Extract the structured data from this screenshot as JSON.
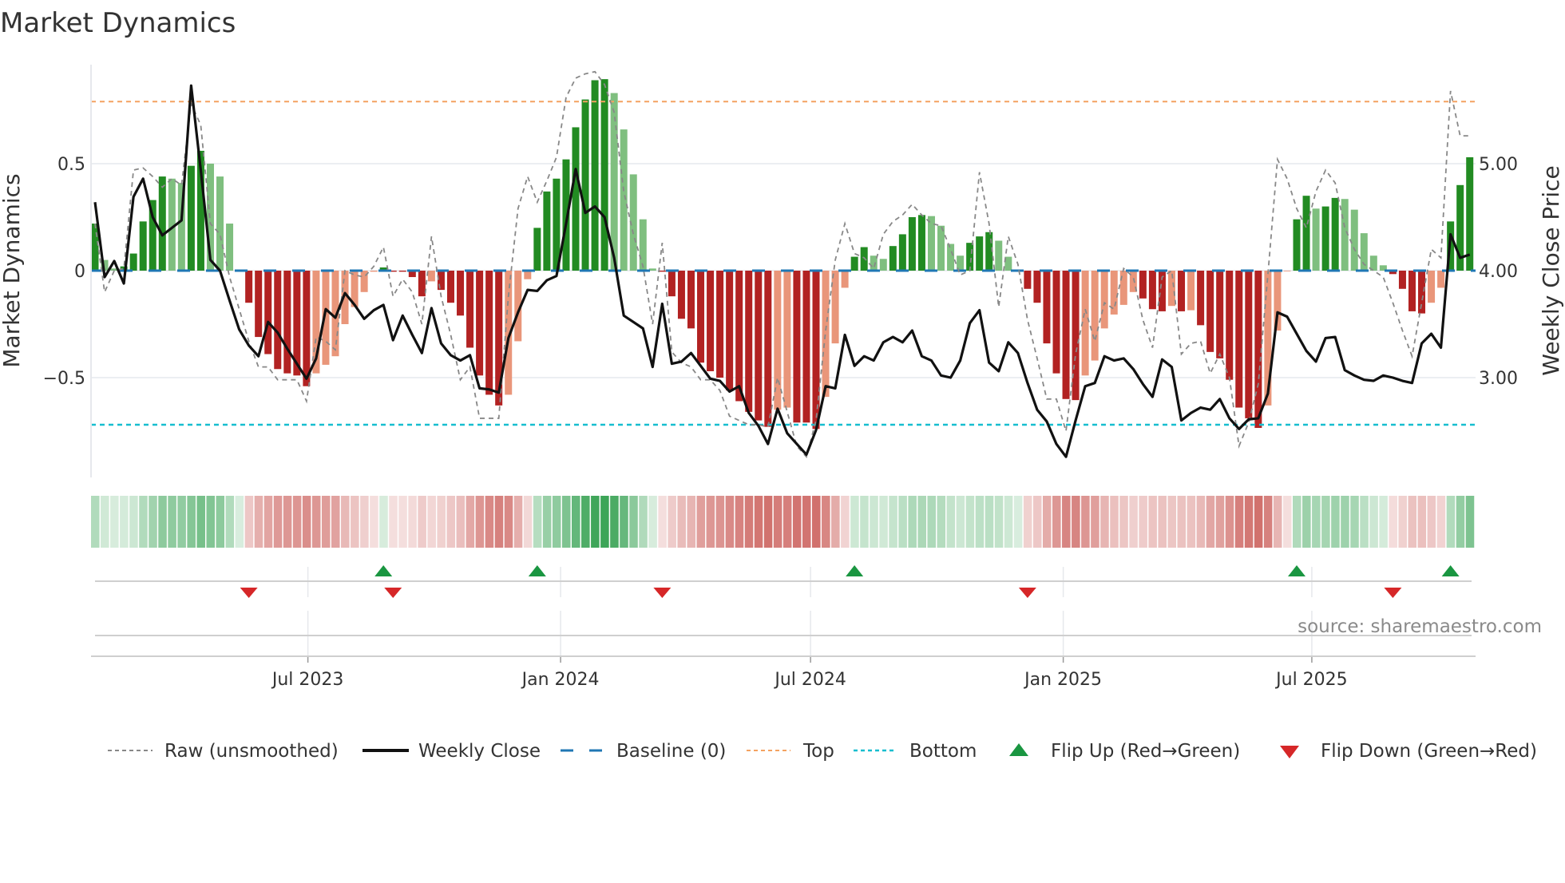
{
  "title": "Market Dynamics",
  "source": "source: sharemaestro.com",
  "chart_data": {
    "type": "bar",
    "title": "Market Dynamics",
    "ylabel": "Market Dynamics",
    "y2label": "Weekly Close Price",
    "ylim": [
      -0.97,
      0.96
    ],
    "y2lim": [
      2.06,
      5.92
    ],
    "frequency": "weekly",
    "start_week": "2023-01-27",
    "yticks": [
      {
        "value": 0.5,
        "label": "0.5"
      },
      {
        "value": 0,
        "label": "0"
      },
      {
        "value": -0.5,
        "label": "−0.5"
      }
    ],
    "y2ticks": [
      {
        "value": 5,
        "label": "5.00"
      },
      {
        "value": 4,
        "label": "4.00"
      },
      {
        "value": 3,
        "label": "3.00"
      }
    ],
    "xticks": [
      {
        "date": "2023-07-01",
        "label": "Jul 2023"
      },
      {
        "date": "2024-01-01",
        "label": "Jan 2024"
      },
      {
        "date": "2024-07-01",
        "label": "Jul 2024"
      },
      {
        "date": "2025-01-01",
        "label": "Jan 2025"
      },
      {
        "date": "2025-07-01",
        "label": "Jul 2025"
      }
    ],
    "top_level": 0.79,
    "bottom_level": -0.72,
    "baseline": 0,
    "colors": {
      "rising_positive": "#228b22",
      "falling_positive": "#7fbf7f",
      "falling_negative": "#b22222",
      "rising_negative": "#e9967a",
      "raw": "#888888",
      "close": "#111111",
      "baseline": "#1f77b4",
      "top": "#f4a261",
      "bottom": "#17becf",
      "flip_up": "#1a9641",
      "flip_down": "#d62728"
    },
    "dynamics": [
      0.22,
      0.05,
      0.01,
      0.02,
      0.08,
      0.23,
      0.33,
      0.44,
      0.43,
      0.41,
      0.49,
      0.56,
      0.5,
      0.44,
      0.22,
      0.003,
      -0.15,
      -0.31,
      -0.39,
      -0.46,
      -0.48,
      -0.49,
      -0.54,
      -0.48,
      -0.44,
      -0.4,
      -0.25,
      -0.17,
      -0.1,
      -0.005,
      0.015,
      -0.005,
      -0.005,
      -0.03,
      -0.12,
      -0.05,
      -0.09,
      -0.15,
      -0.21,
      -0.36,
      -0.49,
      -0.58,
      -0.63,
      -0.58,
      -0.33,
      -0.04,
      0.2,
      0.37,
      0.43,
      0.52,
      0.67,
      0.8,
      0.89,
      0.895,
      0.83,
      0.66,
      0.45,
      0.24,
      0.01,
      -0.005,
      -0.12,
      -0.225,
      -0.27,
      -0.43,
      -0.47,
      -0.5,
      -0.56,
      -0.61,
      -0.66,
      -0.7,
      -0.73,
      -0.65,
      -0.64,
      -0.71,
      -0.71,
      -0.74,
      -0.59,
      -0.34,
      -0.08,
      0.065,
      0.11,
      0.07,
      0.055,
      0.115,
      0.17,
      0.25,
      0.26,
      0.255,
      0.21,
      0.125,
      0.07,
      0.13,
      0.16,
      0.18,
      0.14,
      0.065,
      0.003,
      -0.085,
      -0.15,
      -0.34,
      -0.48,
      -0.6,
      -0.605,
      -0.49,
      -0.42,
      -0.27,
      -0.205,
      -0.16,
      -0.1,
      -0.13,
      -0.18,
      -0.19,
      -0.165,
      -0.19,
      -0.185,
      -0.255,
      -0.38,
      -0.41,
      -0.51,
      -0.64,
      -0.69,
      -0.735,
      -0.63,
      -0.28,
      -0.003,
      0.24,
      0.35,
      0.29,
      0.3,
      0.34,
      0.335,
      0.285,
      0.175,
      0.07,
      0.025,
      -0.016,
      -0.085,
      -0.19,
      -0.2,
      -0.15,
      -0.08,
      0.23,
      0.4,
      0.53
    ],
    "raw": [
      0.22,
      -0.1,
      0.0,
      0.01,
      0.47,
      0.48,
      0.44,
      0.39,
      0.43,
      0.4,
      0.78,
      0.68,
      0.22,
      0.17,
      -0.03,
      -0.18,
      -0.33,
      -0.45,
      -0.45,
      -0.51,
      -0.51,
      -0.51,
      -0.61,
      -0.31,
      -0.33,
      -0.37,
      0.0,
      -0.02,
      -0.03,
      0.02,
      0.11,
      -0.12,
      -0.04,
      -0.1,
      -0.25,
      0.16,
      -0.12,
      -0.3,
      -0.51,
      -0.45,
      -0.69,
      -0.69,
      -0.69,
      -0.12,
      0.29,
      0.44,
      0.32,
      0.42,
      0.53,
      0.81,
      0.9,
      0.92,
      0.93,
      0.87,
      0.74,
      0.37,
      0.17,
      0.02,
      -0.25,
      0.13,
      -0.38,
      -0.43,
      -0.45,
      -0.51,
      -0.51,
      -0.56,
      -0.68,
      -0.7,
      -0.72,
      -0.72,
      -0.73,
      -0.5,
      -0.66,
      -0.82,
      -0.87,
      -0.7,
      -0.28,
      0.05,
      0.22,
      0.08,
      0.06,
      0.01,
      0.17,
      0.23,
      0.26,
      0.31,
      0.26,
      0.22,
      0.21,
      0.1,
      -0.02,
      0.0,
      0.46,
      0.22,
      -0.17,
      0.16,
      0.03,
      -0.23,
      -0.41,
      -0.6,
      -0.6,
      -0.75,
      -0.39,
      -0.18,
      -0.33,
      -0.15,
      -0.18,
      0.01,
      -0.03,
      -0.23,
      -0.36,
      -0.03,
      0.0,
      -0.39,
      -0.34,
      -0.33,
      -0.48,
      -0.39,
      -0.5,
      -0.82,
      -0.71,
      -0.53,
      -0.02,
      0.52,
      0.43,
      0.29,
      0.2,
      0.37,
      0.47,
      0.41,
      0.2,
      0.1,
      0.03,
      0.0,
      -0.03,
      -0.15,
      -0.28,
      -0.4,
      -0.15,
      0.1,
      0.06,
      0.84,
      0.63,
      0.63
    ],
    "weekly_close": [
      4.64,
      3.94,
      4.09,
      3.88,
      4.69,
      4.86,
      4.5,
      4.33,
      4.4,
      4.47,
      5.73,
      4.94,
      4.1,
      4.0,
      3.72,
      3.45,
      3.3,
      3.2,
      3.52,
      3.42,
      3.27,
      3.13,
      2.99,
      3.18,
      3.64,
      3.56,
      3.79,
      3.68,
      3.55,
      3.63,
      3.68,
      3.35,
      3.58,
      3.4,
      3.23,
      3.65,
      3.32,
      3.21,
      3.16,
      3.21,
      2.9,
      2.89,
      2.86,
      3.37,
      3.61,
      3.82,
      3.81,
      3.91,
      3.95,
      4.44,
      4.95,
      4.54,
      4.6,
      4.5,
      4.12,
      3.58,
      3.52,
      3.46,
      3.1,
      3.69,
      3.13,
      3.15,
      3.23,
      3.11,
      2.99,
      2.97,
      2.87,
      2.92,
      2.67,
      2.55,
      2.38,
      2.71,
      2.48,
      2.38,
      2.28,
      2.51,
      2.92,
      2.9,
      3.4,
      3.11,
      3.2,
      3.16,
      3.33,
      3.38,
      3.33,
      3.44,
      3.2,
      3.16,
      3.02,
      3.0,
      3.16,
      3.51,
      3.63,
      3.14,
      3.06,
      3.33,
      3.23,
      2.95,
      2.7,
      2.59,
      2.38,
      2.26,
      2.6,
      2.92,
      2.95,
      3.2,
      3.16,
      3.18,
      3.08,
      2.94,
      2.82,
      3.17,
      3.1,
      2.6,
      2.67,
      2.72,
      2.7,
      2.8,
      2.62,
      2.52,
      2.61,
      2.62,
      2.85,
      3.61,
      3.57,
      3.41,
      3.25,
      3.15,
      3.37,
      3.38,
      3.07,
      3.02,
      2.98,
      2.97,
      3.02,
      3.0,
      2.97,
      2.95,
      3.32,
      3.41,
      3.28,
      4.34,
      4.12,
      4.15
    ],
    "legend": {
      "raw": "Raw (unsmoothed)",
      "close": "Weekly Close",
      "baseline": "Baseline (0)",
      "top": "Top",
      "bottom": "Bottom",
      "flip_up": "Flip Up (Red→Green)",
      "flip_down": "Flip Down (Green→Red)"
    },
    "legend_position": "bottom"
  }
}
